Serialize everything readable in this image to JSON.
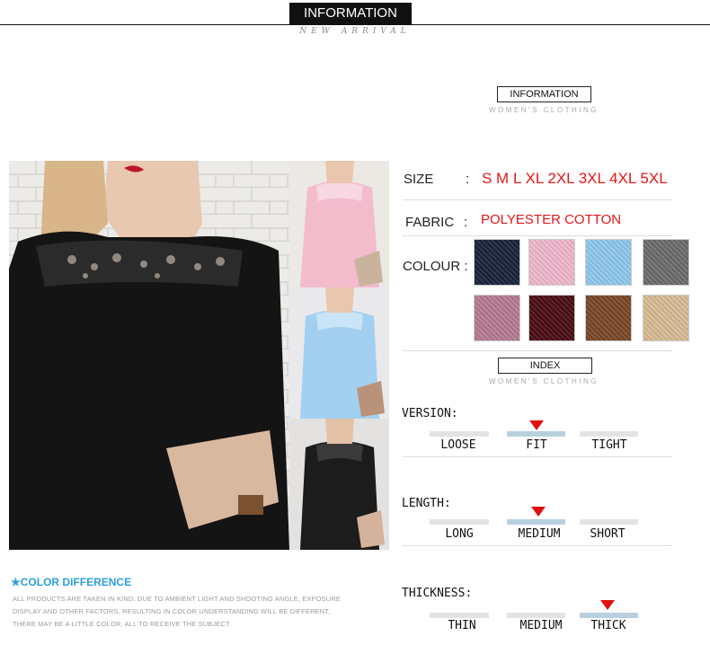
{
  "header": {
    "title": "INFORMATION",
    "subtitle": "NEW ARRIVAL"
  },
  "info_block": {
    "title": "INFORMATION",
    "subtitle": "WOMEN'S CLOTHING"
  },
  "specs": {
    "size_label": "SIZE",
    "size_sep": ":",
    "size_value": "S M L XL 2XL 3XL 4XL 5XL",
    "fabric_label": "FABRIC",
    "fabric_sep": ":",
    "fabric_value": "POLYESTER COTTON",
    "colour_label": "COLOUR :",
    "swatches": [
      "#17223a",
      "#f0b7cc",
      "#8ec8ee",
      "#6b6b6b",
      "#b57a93",
      "#4a0c14",
      "#7a4526",
      "#d8bb93"
    ]
  },
  "index_block": {
    "title": "INDEX",
    "subtitle": "WOMEN'S CLOTHING"
  },
  "version": {
    "label": "VERSION:",
    "options": [
      "LOOSE",
      "FIT",
      "TIGHT"
    ],
    "selected": "FIT"
  },
  "length": {
    "label": "LENGTH:",
    "options": [
      "LONG",
      "MEDIUM",
      "SHORT"
    ],
    "selected": "MEDIUM"
  },
  "thickness": {
    "label": "THICKNESS:",
    "options": [
      "THIN",
      "MEDIUM",
      "THICK"
    ],
    "selected": "THICK"
  },
  "color_difference": {
    "title": "COLOR DIFFERENCE",
    "lines": [
      "ALL PRODUCTS ARE TAKEN IN KIND, DUE TO AMBIENT LIGHT AND SHOOTING ANGLE, EXPOSURE",
      "DISPLAY AND OTHER FACTORS, RESULTING IN COLOR UNDERSTANDING WILL BE DIFFERENT,",
      "THERE MAY BE A LITTLE COLOR, ALL TO RECEIVE THE SUBJECT."
    ]
  },
  "colors": {
    "accent_red": "#e01818",
    "accent_blue": "#2f9fd8"
  }
}
